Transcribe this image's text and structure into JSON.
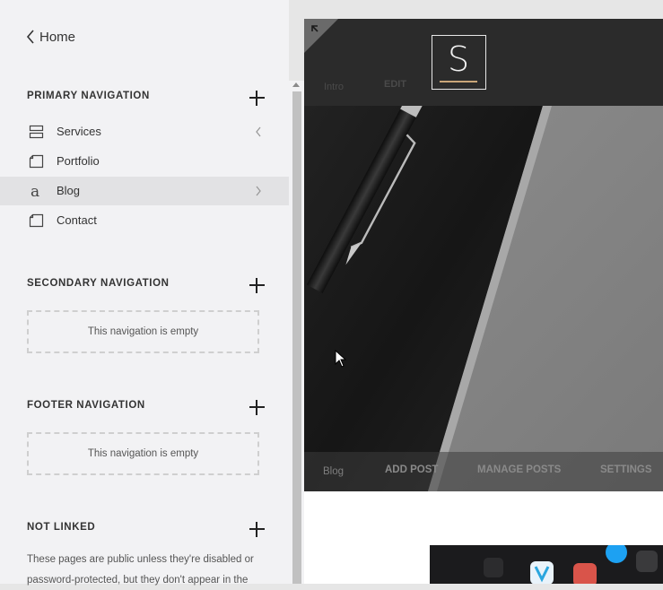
{
  "sidebar": {
    "back_label": "Home",
    "primary": {
      "title": "PRIMARY NAVIGATION",
      "items": [
        {
          "label": "Services",
          "icon": "folder-icon",
          "chevron": "left"
        },
        {
          "label": "Portfolio",
          "icon": "page-icon",
          "chevron": ""
        },
        {
          "label": "Blog",
          "icon": "blog-icon",
          "chevron": "right",
          "active": true
        },
        {
          "label": "Contact",
          "icon": "page-icon",
          "chevron": ""
        }
      ]
    },
    "secondary": {
      "title": "SECONDARY NAVIGATION",
      "empty_text": "This navigation is empty"
    },
    "footer": {
      "title": "FOOTER NAVIGATION",
      "empty_text": "This navigation is empty"
    },
    "not_linked": {
      "title": "NOT LINKED",
      "description": "These pages are public unless they're disabled or password-protected, but they don't appear in the"
    }
  },
  "preview": {
    "logo_letter": "S",
    "header_links": {
      "intro": "Intro",
      "edit": "EDIT"
    },
    "blog_bar": {
      "blog": "Blog",
      "add_post": "ADD POST",
      "manage_posts": "MANAGE POSTS",
      "settings": "SETTINGS"
    }
  },
  "colors": {
    "sidebar_bg": "#f2f2f4",
    "active_item_bg": "#e2e2e4",
    "header_bg": "#2b2b2b",
    "logo_accent": "#c9a678"
  }
}
